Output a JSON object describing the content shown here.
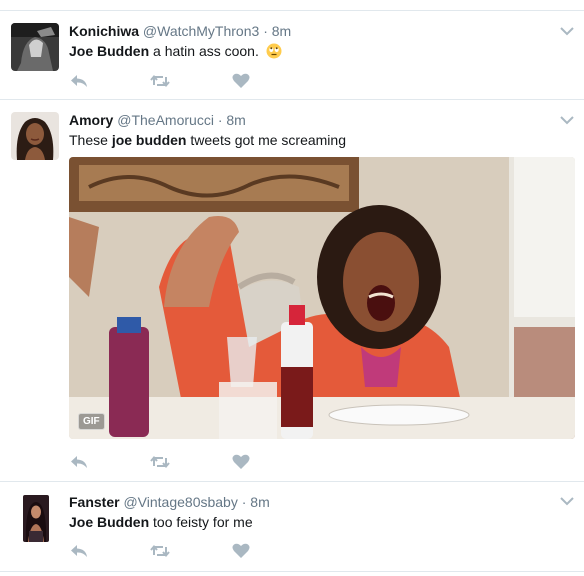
{
  "tweets": [
    {
      "fullname": "Konichiwa",
      "handle": "@WatchMyThron3",
      "separator": "·",
      "time": "8m",
      "text_bold": "Joe Budden",
      "text_rest": " a hatin ass coon.",
      "emoji": "rolling-eyes-emoji"
    },
    {
      "fullname": "Amory",
      "handle": "@TheAmorucci",
      "separator": "·",
      "time": "8m",
      "text_pre": "These ",
      "text_bold": "joe budden",
      "text_rest": " tweets got me screaming",
      "media_badge": "GIF"
    },
    {
      "fullname": "Fanster",
      "handle": "@Vintage80sbaby",
      "separator": "·",
      "time": "8m",
      "text_bold": "Joe Budden",
      "text_rest": " too feisty for me"
    }
  ],
  "icons": {
    "reply": "reply-icon",
    "retweet": "retweet-icon",
    "like": "heart-icon",
    "more": "chevron-down-icon"
  },
  "colors": {
    "icon_gray": "#aab8c2",
    "text_gray": "#657786",
    "divider": "#e1e8ed"
  }
}
